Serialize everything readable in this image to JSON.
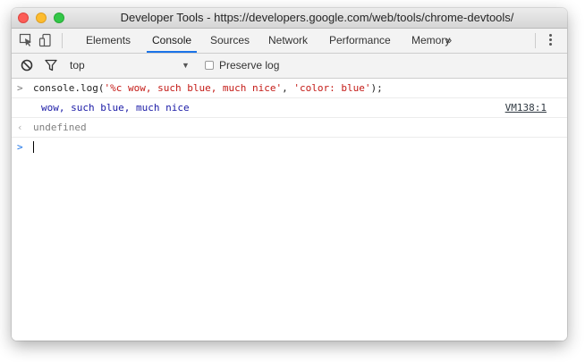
{
  "window": {
    "title": "Developer Tools - https://developers.google.com/web/tools/chrome-devtools/"
  },
  "tabs": [
    {
      "label": "Elements",
      "active": false
    },
    {
      "label": "Console",
      "active": true
    },
    {
      "label": "Sources",
      "active": false
    },
    {
      "label": "Network",
      "active": false
    },
    {
      "label": "Performance",
      "active": false
    },
    {
      "label": "Memory",
      "active": false
    }
  ],
  "more_tabs_label": "»",
  "toolbar": {
    "context": "top",
    "preserve_log_label": "Preserve log",
    "preserve_log_checked": false
  },
  "console": {
    "command_prefix": "console.log(",
    "command_arg1": "'%c wow, such blue, much nice'",
    "command_sep": ", ",
    "command_arg2": "'color: blue'",
    "command_suffix": ");",
    "output_text": "wow, such blue, much nice",
    "output_source": "VM138:1",
    "return_value": "undefined"
  },
  "colors": {
    "accent": "#1a73e8",
    "styled_output": "#1a1aa6",
    "string_literal": "#c41a16"
  },
  "icons": [
    "inspect-element-icon",
    "device-toolbar-icon",
    "clear-console-icon",
    "filter-icon",
    "kebab-menu-icon"
  ]
}
